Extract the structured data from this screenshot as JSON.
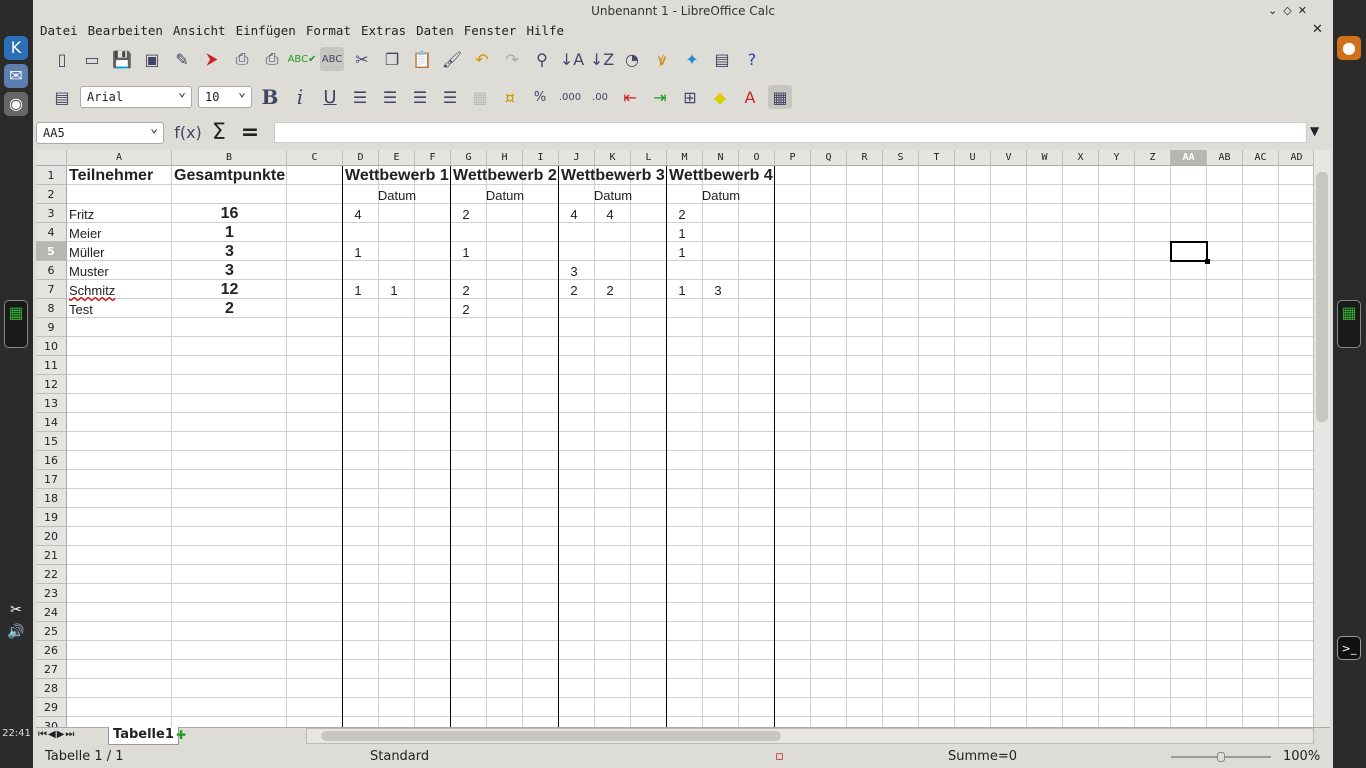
{
  "window": {
    "title": "Unbenannt 1 - LibreOffice Calc",
    "clock": "22:41"
  },
  "menu": [
    "Datei",
    "Bearbeiten",
    "Ansicht",
    "Einfügen",
    "Format",
    "Extras",
    "Daten",
    "Fenster",
    "Hilfe"
  ],
  "format_bar": {
    "font_name": "Arial",
    "font_size": "10"
  },
  "formula_bar": {
    "name_box": "AA5",
    "content": ""
  },
  "columns": [
    "A",
    "B",
    "C",
    "D",
    "E",
    "F",
    "G",
    "H",
    "I",
    "J",
    "K",
    "L",
    "M",
    "N",
    "O",
    "P",
    "Q",
    "R",
    "S",
    "T",
    "U",
    "V",
    "W",
    "X",
    "Y",
    "Z",
    "AA",
    "AB",
    "AC",
    "AD"
  ],
  "row_count": 30,
  "selected": {
    "column": "AA",
    "row": 5
  },
  "cells": {
    "A1": "Teilnehmer",
    "B1": "Gesamtpunkte",
    "D1": "Wettbewerb 1",
    "G1": "Wettbewerb 2",
    "J1": "Wettbewerb 3",
    "M1": "Wettbewerb 4",
    "E2": "Datum",
    "H2": "Datum",
    "K2": "Datum",
    "N2": "Datum",
    "A3": "Fritz",
    "B3": "16",
    "D3": "4",
    "G3": "2",
    "J3": "4",
    "K3": "4",
    "M3": "2",
    "A4": "Meier",
    "B4": "1",
    "M4": "1",
    "A5": "Müller",
    "B5": "3",
    "D5": "1",
    "G5": "1",
    "M5": "1",
    "A6": "Muster",
    "B6": "3",
    "J6": "3",
    "A7": "Schmitz",
    "B7": "12",
    "D7": "1",
    "E7": "1",
    "G7": "2",
    "J7": "2",
    "K7": "2",
    "M7": "1",
    "N7": "3",
    "A8": "Test",
    "B8": "2",
    "G8": "2"
  },
  "sheet_tab": "Tabelle1",
  "status": {
    "sheet": "Tabelle 1 / 1",
    "style": "Standard",
    "sum": "Summe=0",
    "zoom": "100%"
  }
}
